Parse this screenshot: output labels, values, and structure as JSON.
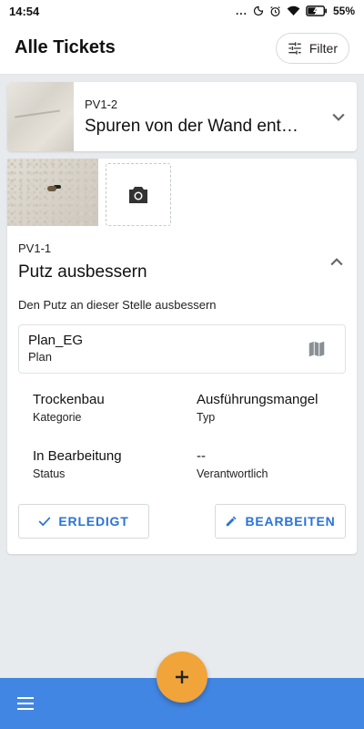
{
  "status_bar": {
    "time": "14:54",
    "signal_dots": "...",
    "battery_percent": "55%",
    "icons": [
      "moon-icon",
      "alarm-icon",
      "wifi-icon",
      "battery-charging-icon"
    ]
  },
  "app_bar": {
    "title": "Alle Tickets",
    "filter_label": "Filter",
    "filter_icon": "tune-icon"
  },
  "tickets": [
    {
      "id": "PV1-2",
      "title": "Spuren von der Wand ent…",
      "expanded": false
    },
    {
      "id": "PV1-1",
      "title": "Putz ausbessern",
      "expanded": true,
      "description": "Den Putz an dieser Stelle ausbessern",
      "plan": {
        "name": "Plan_EG",
        "label": "Plan"
      },
      "fields": {
        "category": {
          "value": "Trockenbau",
          "label": "Kategorie"
        },
        "type": {
          "value": "Ausführungsmangel",
          "label": "Typ"
        },
        "status": {
          "value": "In Bearbeitung",
          "label": "Status"
        },
        "responsible": {
          "value": "--",
          "label": "Verantwortlich"
        }
      },
      "actions": {
        "done": "ERLEDIGT",
        "edit": "BEARBEITEN"
      }
    }
  ],
  "colors": {
    "accent_blue": "#2a73d6",
    "bottom_bar": "#4286e4",
    "fab": "#f0a43a",
    "background": "#e8ebee"
  }
}
